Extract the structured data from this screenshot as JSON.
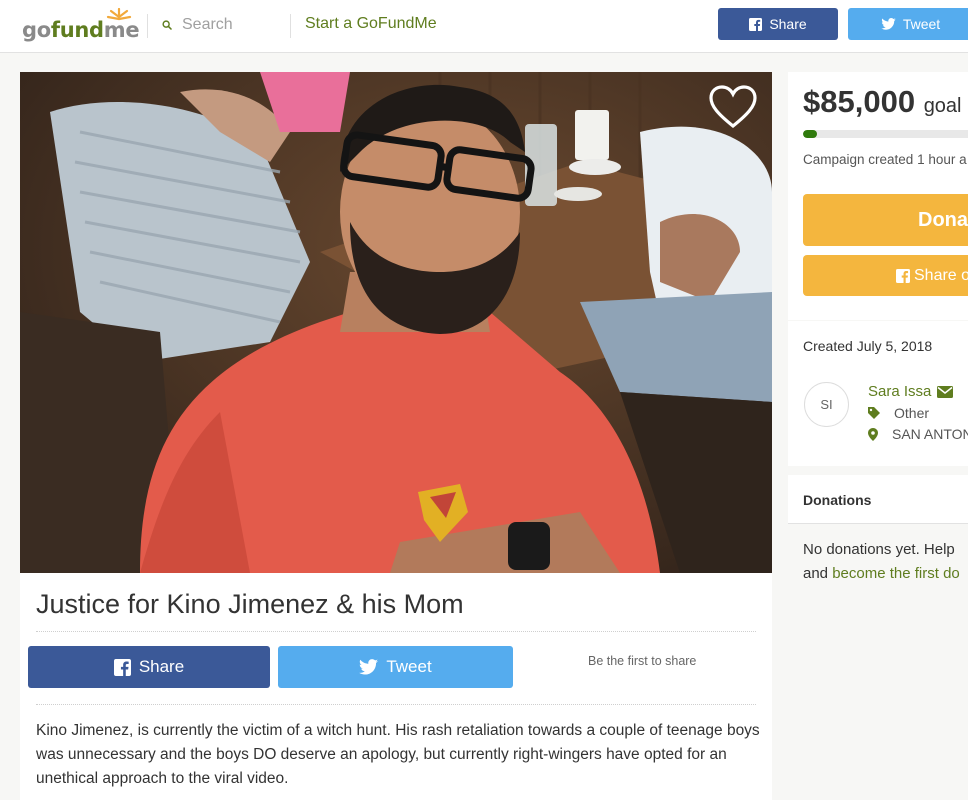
{
  "header": {
    "logo_alt": "gofundme",
    "logo_part1": "go",
    "logo_part2": "fund",
    "logo_part3": "me",
    "search_placeholder": "Search",
    "start_link": "Start a GoFundMe",
    "share_label": "Share",
    "tweet_label": "Tweet"
  },
  "campaign": {
    "title": "Justice for Kino Jimenez & his Mom",
    "share_label": "Share",
    "tweet_label": "Tweet",
    "first_to_share": "Be the first to share",
    "story": "Kino Jimenez, is currently the victim of a witch hunt. His rash retaliation towards a couple of teenage boys was unnecessary and the boys DO deserve an apology, but currently right-wingers have opted for an unethical approach to the viral video."
  },
  "sidebar": {
    "goal_amount": "$85,000",
    "goal_label": "goal",
    "progress_fraction": 0.0,
    "created_ago": "Campaign created 1 hour a",
    "donate_label": "Donat",
    "share_on_label": "Share o",
    "created_date": "Created July 5, 2018",
    "organizer_initials": "SI",
    "organizer_name": "Sara Issa",
    "category": "Other",
    "location": "SAN ANTON",
    "donations_heading": "Donations",
    "no_donations_line1": "No donations yet. Help",
    "no_donations_and": "and",
    "become_first_link": "become the first do"
  },
  "colors": {
    "brand_green": "#5f7d1f",
    "facebook": "#3b5998",
    "twitter": "#55acee",
    "donate_orange": "#f4b63e",
    "progress_green": "#2f7a0c"
  },
  "icons": [
    "search-icon",
    "facebook-icon",
    "twitter-icon",
    "heart-icon",
    "envelope-icon",
    "tag-icon",
    "map-marker-icon",
    "logo-sun-icon"
  ]
}
